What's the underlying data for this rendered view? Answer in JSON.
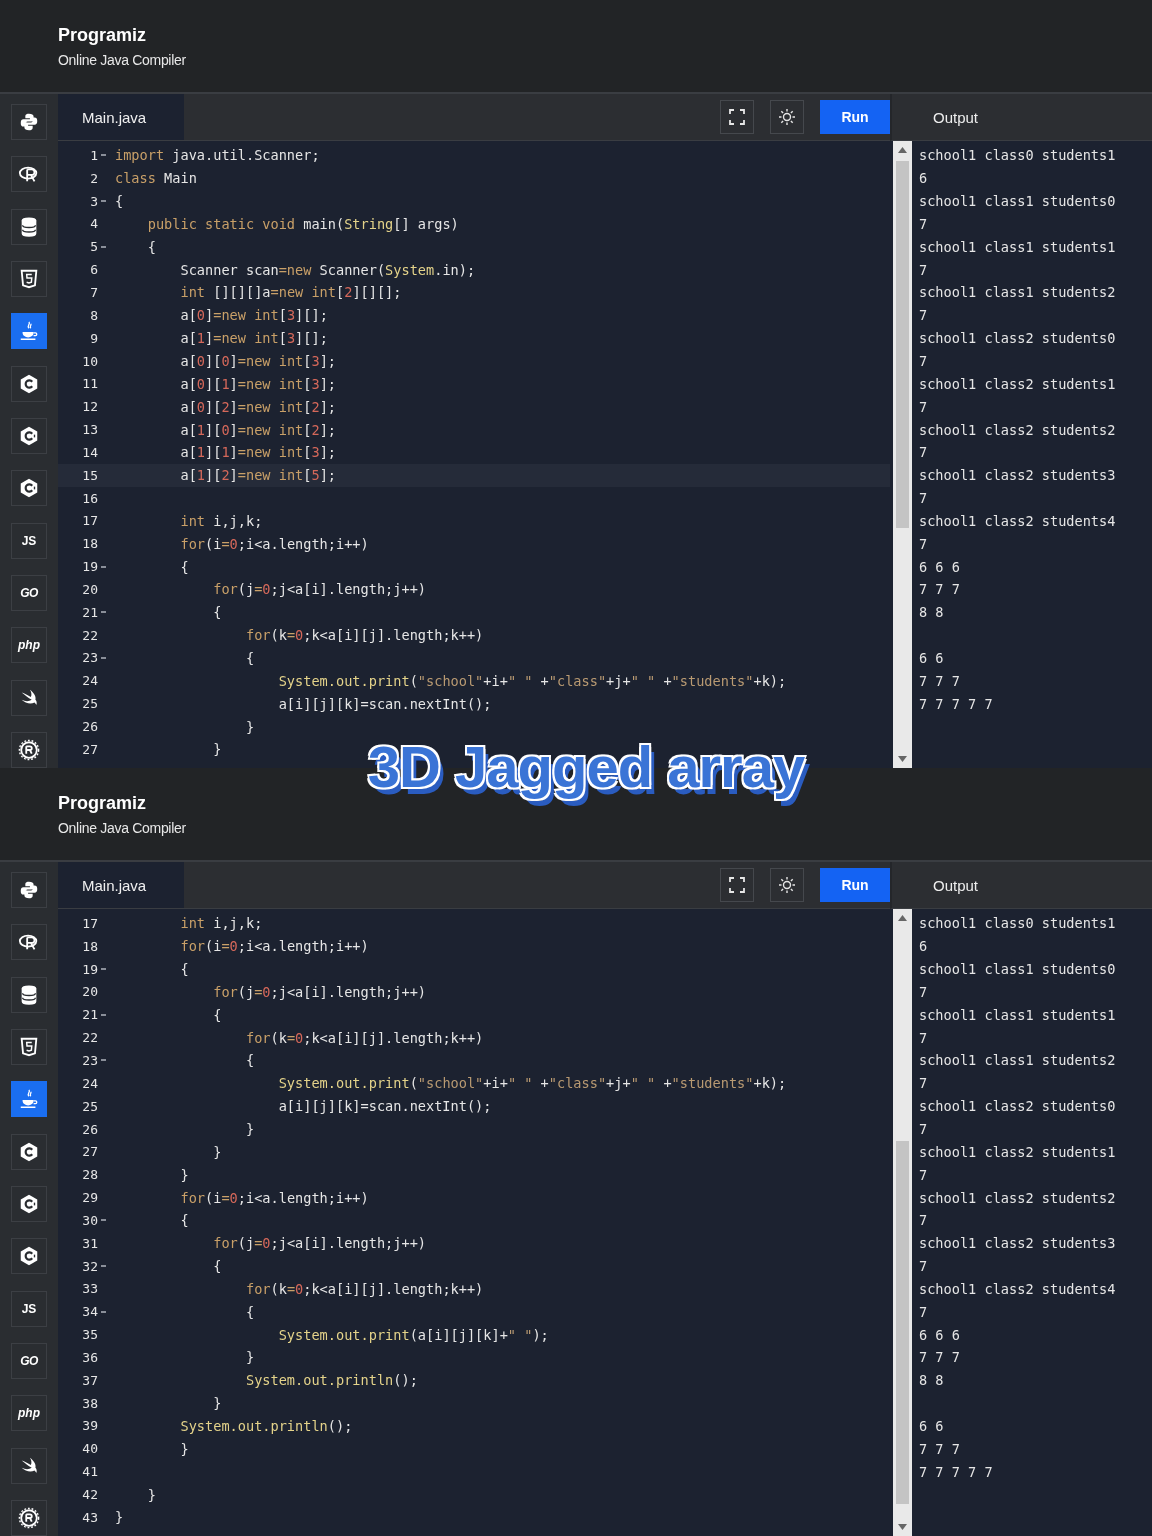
{
  "caption": "3D Jagged array",
  "panels": [
    {
      "header": {
        "logo": "Programiz",
        "subtitle": "Online Java Compiler"
      },
      "sidebar": {
        "items": [
          {
            "kind": "python",
            "selected": false
          },
          {
            "kind": "r",
            "selected": false
          },
          {
            "kind": "database",
            "selected": false
          },
          {
            "kind": "html",
            "selected": false
          },
          {
            "kind": "java",
            "selected": true
          },
          {
            "kind": "c",
            "selected": false
          },
          {
            "kind": "cpp",
            "selected": false
          },
          {
            "kind": "csharp",
            "selected": false
          },
          {
            "kind": "text",
            "label": "JS",
            "selected": false
          },
          {
            "kind": "go",
            "label": "GO",
            "selected": false
          },
          {
            "kind": "text",
            "label": "php",
            "italic": true,
            "selected": false
          },
          {
            "kind": "swift",
            "selected": false
          },
          {
            "kind": "rust",
            "selected": false
          }
        ]
      },
      "editor": {
        "tab": "Main.java",
        "run_label": "Run",
        "lines": [
          {
            "number": "1",
            "fold": true,
            "active": false,
            "segments": [
              {
                "kind": "keyword",
                "text": "import"
              },
              {
                "kind": "plain",
                "text": " java.util.Scanner;"
              }
            ]
          },
          {
            "number": "2",
            "fold": false,
            "active": false,
            "segments": [
              {
                "kind": "keyword",
                "text": "class"
              },
              {
                "kind": "plain",
                "text": " Main"
              }
            ]
          },
          {
            "number": "3",
            "fold": true,
            "active": false,
            "segments": [
              {
                "kind": "plain",
                "text": "{"
              }
            ]
          },
          {
            "number": "4",
            "fold": false,
            "active": false,
            "segments": [
              {
                "kind": "keyword",
                "text": "    public static void"
              },
              {
                "kind": "plain",
                "text": " main("
              },
              {
                "kind": "type",
                "text": "String"
              },
              {
                "kind": "plain",
                "text": "[] args)"
              }
            ]
          },
          {
            "number": "5",
            "fold": true,
            "active": false,
            "segments": [
              {
                "kind": "plain",
                "text": "    {"
              }
            ]
          },
          {
            "number": "6",
            "fold": false,
            "active": false,
            "segments": [
              {
                "kind": "plain",
                "text": "        Scanner scan"
              },
              {
                "kind": "keyword",
                "text": "=new"
              },
              {
                "kind": "plain",
                "text": " Scanner("
              },
              {
                "kind": "type",
                "text": "System"
              },
              {
                "kind": "plain",
                "text": ".in);"
              }
            ]
          },
          {
            "number": "7",
            "fold": false,
            "active": false,
            "segments": [
              {
                "kind": "keyword",
                "text": "        int"
              },
              {
                "kind": "plain",
                "text": " [][][]a"
              },
              {
                "kind": "keyword",
                "text": "=new int"
              },
              {
                "kind": "plain",
                "text": "["
              },
              {
                "kind": "number",
                "text": "2"
              },
              {
                "kind": "plain",
                "text": "][][];"
              }
            ]
          },
          {
            "number": "8",
            "fold": false,
            "active": false,
            "segments": [
              {
                "kind": "plain",
                "text": "        a["
              },
              {
                "kind": "number",
                "text": "0"
              },
              {
                "kind": "plain",
                "text": "]"
              },
              {
                "kind": "keyword",
                "text": "=new int"
              },
              {
                "kind": "plain",
                "text": "["
              },
              {
                "kind": "number",
                "text": "3"
              },
              {
                "kind": "plain",
                "text": "][];"
              }
            ]
          },
          {
            "number": "9",
            "fold": false,
            "active": false,
            "segments": [
              {
                "kind": "plain",
                "text": "        a["
              },
              {
                "kind": "number",
                "text": "1"
              },
              {
                "kind": "plain",
                "text": "]"
              },
              {
                "kind": "keyword",
                "text": "=new int"
              },
              {
                "kind": "plain",
                "text": "["
              },
              {
                "kind": "number",
                "text": "3"
              },
              {
                "kind": "plain",
                "text": "][];"
              }
            ]
          },
          {
            "number": "10",
            "fold": false,
            "active": false,
            "segments": [
              {
                "kind": "plain",
                "text": "        a["
              },
              {
                "kind": "number",
                "text": "0"
              },
              {
                "kind": "plain",
                "text": "]["
              },
              {
                "kind": "number",
                "text": "0"
              },
              {
                "kind": "plain",
                "text": "]"
              },
              {
                "kind": "keyword",
                "text": "=new int"
              },
              {
                "kind": "plain",
                "text": "["
              },
              {
                "kind": "number",
                "text": "3"
              },
              {
                "kind": "plain",
                "text": "];"
              }
            ]
          },
          {
            "number": "11",
            "fold": false,
            "active": false,
            "segments": [
              {
                "kind": "plain",
                "text": "        a["
              },
              {
                "kind": "number",
                "text": "0"
              },
              {
                "kind": "plain",
                "text": "]["
              },
              {
                "kind": "number",
                "text": "1"
              },
              {
                "kind": "plain",
                "text": "]"
              },
              {
                "kind": "keyword",
                "text": "=new int"
              },
              {
                "kind": "plain",
                "text": "["
              },
              {
                "kind": "number",
                "text": "3"
              },
              {
                "kind": "plain",
                "text": "];"
              }
            ]
          },
          {
            "number": "12",
            "fold": false,
            "active": false,
            "segments": [
              {
                "kind": "plain",
                "text": "        a["
              },
              {
                "kind": "number",
                "text": "0"
              },
              {
                "kind": "plain",
                "text": "]["
              },
              {
                "kind": "number",
                "text": "2"
              },
              {
                "kind": "plain",
                "text": "]"
              },
              {
                "kind": "keyword",
                "text": "=new int"
              },
              {
                "kind": "plain",
                "text": "["
              },
              {
                "kind": "number",
                "text": "2"
              },
              {
                "kind": "plain",
                "text": "];"
              }
            ]
          },
          {
            "number": "13",
            "fold": false,
            "active": false,
            "segments": [
              {
                "kind": "plain",
                "text": "        a["
              },
              {
                "kind": "number",
                "text": "1"
              },
              {
                "kind": "plain",
                "text": "]["
              },
              {
                "kind": "number",
                "text": "0"
              },
              {
                "kind": "plain",
                "text": "]"
              },
              {
                "kind": "keyword",
                "text": "=new int"
              },
              {
                "kind": "plain",
                "text": "["
              },
              {
                "kind": "number",
                "text": "2"
              },
              {
                "kind": "plain",
                "text": "];"
              }
            ]
          },
          {
            "number": "14",
            "fold": false,
            "active": false,
            "segments": [
              {
                "kind": "plain",
                "text": "        a["
              },
              {
                "kind": "number",
                "text": "1"
              },
              {
                "kind": "plain",
                "text": "]["
              },
              {
                "kind": "number",
                "text": "1"
              },
              {
                "kind": "plain",
                "text": "]"
              },
              {
                "kind": "keyword",
                "text": "=new int"
              },
              {
                "kind": "plain",
                "text": "["
              },
              {
                "kind": "number",
                "text": "3"
              },
              {
                "kind": "plain",
                "text": "];"
              }
            ]
          },
          {
            "number": "15",
            "fold": false,
            "active": true,
            "segments": [
              {
                "kind": "plain",
                "text": "        a["
              },
              {
                "kind": "number",
                "text": "1"
              },
              {
                "kind": "plain",
                "text": "]["
              },
              {
                "kind": "number",
                "text": "2"
              },
              {
                "kind": "plain",
                "text": "]"
              },
              {
                "kind": "keyword",
                "text": "=new int"
              },
              {
                "kind": "plain",
                "text": "["
              },
              {
                "kind": "number",
                "text": "5"
              },
              {
                "kind": "plain",
                "text": "];"
              }
            ]
          },
          {
            "number": "16",
            "fold": false,
            "active": false
          },
          {
            "number": "17",
            "fold": false,
            "active": false,
            "segments": [
              {
                "kind": "keyword",
                "text": "        int"
              },
              {
                "kind": "plain",
                "text": " i,j,k;"
              }
            ]
          },
          {
            "number": "18",
            "fold": false,
            "active": false,
            "segments": [
              {
                "kind": "keyword",
                "text": "        for"
              },
              {
                "kind": "plain",
                "text": "(i"
              },
              {
                "kind": "keyword",
                "text": "="
              },
              {
                "kind": "number",
                "text": "0"
              },
              {
                "kind": "plain",
                "text": ";i<a.length;i++)"
              }
            ]
          },
          {
            "number": "19",
            "fold": true,
            "active": false,
            "segments": [
              {
                "kind": "plain",
                "text": "        {"
              }
            ]
          },
          {
            "number": "20",
            "fold": false,
            "active": false,
            "segments": [
              {
                "kind": "keyword",
                "text": "            for"
              },
              {
                "kind": "plain",
                "text": "(j"
              },
              {
                "kind": "keyword",
                "text": "="
              },
              {
                "kind": "number",
                "text": "0"
              },
              {
                "kind": "plain",
                "text": ";j<a[i].length;j++)"
              }
            ]
          },
          {
            "number": "21",
            "fold": true,
            "active": false,
            "segments": [
              {
                "kind": "plain",
                "text": "            {"
              }
            ]
          },
          {
            "number": "22",
            "fold": false,
            "active": false,
            "segments": [
              {
                "kind": "keyword",
                "text": "                for"
              },
              {
                "kind": "plain",
                "text": "(k"
              },
              {
                "kind": "keyword",
                "text": "="
              },
              {
                "kind": "number",
                "text": "0"
              },
              {
                "kind": "plain",
                "text": ";k<a[i][j].length;k++)"
              }
            ]
          },
          {
            "number": "23",
            "fold": true,
            "active": false,
            "segments": [
              {
                "kind": "plain",
                "text": "                {"
              }
            ]
          },
          {
            "number": "24",
            "fold": false,
            "active": false,
            "segments": [
              {
                "kind": "type",
                "text": "                    System.out.print"
              },
              {
                "kind": "plain",
                "text": "("
              },
              {
                "kind": "string",
                "text": "\"school\""
              },
              {
                "kind": "plain",
                "text": "+i+"
              },
              {
                "kind": "string",
                "text": "\" \""
              },
              {
                "kind": "plain",
                "text": " +"
              },
              {
                "kind": "string",
                "text": "\"class\""
              },
              {
                "kind": "plain",
                "text": "+j+"
              },
              {
                "kind": "string",
                "text": "\" \""
              },
              {
                "kind": "plain",
                "text": " +"
              },
              {
                "kind": "string",
                "text": "\"students\""
              },
              {
                "kind": "plain",
                "text": "+k);"
              }
            ]
          },
          {
            "number": "25",
            "fold": false,
            "active": false,
            "segments": [
              {
                "kind": "plain",
                "text": "                    a[i][j][k]=scan.nextInt();"
              }
            ]
          },
          {
            "number": "26",
            "fold": false,
            "active": false,
            "segments": [
              {
                "kind": "plain",
                "text": "                }"
              }
            ]
          },
          {
            "number": "27",
            "fold": false,
            "active": false,
            "segments": [
              {
                "kind": "plain",
                "text": "            }"
              }
            ]
          }
        ]
      },
      "output": {
        "title": "Output",
        "scrolled": false,
        "groups": [
          [
            "school1 class0 students1",
            "6",
            "school1 class1 students0",
            "7",
            "school1 class1 students1",
            "7",
            "school1 class1 students2",
            "7",
            "school1 class2 students0",
            "7",
            "school1 class2 students1",
            "7",
            "school1 class2 students2",
            "7",
            "school1 class2 students3",
            "7",
            "school1 class2 students4",
            "7",
            "6 6 6",
            "7 7 7",
            "8 8"
          ],
          [
            "6 6",
            "7 7 7",
            "7 7 7 7 7"
          ]
        ]
      }
    },
    {
      "header": {
        "logo": "Programiz",
        "subtitle": "Online Java Compiler"
      },
      "sidebar": {
        "items": [
          {
            "kind": "python",
            "selected": false
          },
          {
            "kind": "r",
            "selected": false
          },
          {
            "kind": "database",
            "selected": false
          },
          {
            "kind": "html",
            "selected": false
          },
          {
            "kind": "java",
            "selected": true
          },
          {
            "kind": "c",
            "selected": false
          },
          {
            "kind": "cpp",
            "selected": false
          },
          {
            "kind": "csharp",
            "selected": false
          },
          {
            "kind": "text",
            "label": "JS",
            "selected": false
          },
          {
            "kind": "go",
            "label": "GO",
            "selected": false
          },
          {
            "kind": "text",
            "label": "php",
            "italic": true,
            "selected": false
          },
          {
            "kind": "swift",
            "selected": false
          },
          {
            "kind": "rust",
            "selected": false
          }
        ]
      },
      "editor": {
        "tab": "Main.java",
        "run_label": "Run",
        "lines": [
          {
            "number": "17",
            "fold": false,
            "active": false,
            "segments": [
              {
                "kind": "keyword",
                "text": "        int"
              },
              {
                "kind": "plain",
                "text": " i,j,k;"
              }
            ]
          },
          {
            "number": "18",
            "fold": false,
            "active": false,
            "segments": [
              {
                "kind": "keyword",
                "text": "        for"
              },
              {
                "kind": "plain",
                "text": "(i"
              },
              {
                "kind": "keyword",
                "text": "="
              },
              {
                "kind": "number",
                "text": "0"
              },
              {
                "kind": "plain",
                "text": ";i<a.length;i++)"
              }
            ]
          },
          {
            "number": "19",
            "fold": true,
            "active": false,
            "segments": [
              {
                "kind": "plain",
                "text": "        {"
              }
            ]
          },
          {
            "number": "20",
            "fold": false,
            "active": false,
            "segments": [
              {
                "kind": "keyword",
                "text": "            for"
              },
              {
                "kind": "plain",
                "text": "(j"
              },
              {
                "kind": "keyword",
                "text": "="
              },
              {
                "kind": "number",
                "text": "0"
              },
              {
                "kind": "plain",
                "text": ";j<a[i].length;j++)"
              }
            ]
          },
          {
            "number": "21",
            "fold": true,
            "active": false,
            "segments": [
              {
                "kind": "plain",
                "text": "            {"
              }
            ]
          },
          {
            "number": "22",
            "fold": false,
            "active": false,
            "segments": [
              {
                "kind": "keyword",
                "text": "                for"
              },
              {
                "kind": "plain",
                "text": "(k"
              },
              {
                "kind": "keyword",
                "text": "="
              },
              {
                "kind": "number",
                "text": "0"
              },
              {
                "kind": "plain",
                "text": ";k<a[i][j].length;k++)"
              }
            ]
          },
          {
            "number": "23",
            "fold": true,
            "active": false,
            "segments": [
              {
                "kind": "plain",
                "text": "                {"
              }
            ]
          },
          {
            "number": "24",
            "fold": false,
            "active": false,
            "segments": [
              {
                "kind": "type",
                "text": "                    System.out.print"
              },
              {
                "kind": "plain",
                "text": "("
              },
              {
                "kind": "string",
                "text": "\"school\""
              },
              {
                "kind": "plain",
                "text": "+i+"
              },
              {
                "kind": "string",
                "text": "\" \""
              },
              {
                "kind": "plain",
                "text": " +"
              },
              {
                "kind": "string",
                "text": "\"class\""
              },
              {
                "kind": "plain",
                "text": "+j+"
              },
              {
                "kind": "string",
                "text": "\" \""
              },
              {
                "kind": "plain",
                "text": " +"
              },
              {
                "kind": "string",
                "text": "\"students\""
              },
              {
                "kind": "plain",
                "text": "+k);"
              }
            ]
          },
          {
            "number": "25",
            "fold": false,
            "active": false,
            "segments": [
              {
                "kind": "plain",
                "text": "                    a[i][j][k]=scan.nextInt();"
              }
            ]
          },
          {
            "number": "26",
            "fold": false,
            "active": false,
            "segments": [
              {
                "kind": "plain",
                "text": "                }"
              }
            ]
          },
          {
            "number": "27",
            "fold": false,
            "active": false,
            "segments": [
              {
                "kind": "plain",
                "text": "            }"
              }
            ]
          },
          {
            "number": "28",
            "fold": false,
            "active": false,
            "segments": [
              {
                "kind": "plain",
                "text": "        }"
              }
            ]
          },
          {
            "number": "29",
            "fold": false,
            "active": false,
            "segments": [
              {
                "kind": "keyword",
                "text": "        for"
              },
              {
                "kind": "plain",
                "text": "(i"
              },
              {
                "kind": "keyword",
                "text": "="
              },
              {
                "kind": "number",
                "text": "0"
              },
              {
                "kind": "plain",
                "text": ";i<a.length;i++)"
              }
            ]
          },
          {
            "number": "30",
            "fold": true,
            "active": false,
            "segments": [
              {
                "kind": "plain",
                "text": "        {"
              }
            ]
          },
          {
            "number": "31",
            "fold": false,
            "active": false,
            "segments": [
              {
                "kind": "keyword",
                "text": "            for"
              },
              {
                "kind": "plain",
                "text": "(j"
              },
              {
                "kind": "keyword",
                "text": "="
              },
              {
                "kind": "number",
                "text": "0"
              },
              {
                "kind": "plain",
                "text": ";j<a[i].length;j++)"
              }
            ]
          },
          {
            "number": "32",
            "fold": true,
            "active": false,
            "segments": [
              {
                "kind": "plain",
                "text": "            {"
              }
            ]
          },
          {
            "number": "33",
            "fold": false,
            "active": false,
            "segments": [
              {
                "kind": "keyword",
                "text": "                for"
              },
              {
                "kind": "plain",
                "text": "(k"
              },
              {
                "kind": "keyword",
                "text": "="
              },
              {
                "kind": "number",
                "text": "0"
              },
              {
                "kind": "plain",
                "text": ";k<a[i][j].length;k++)"
              }
            ]
          },
          {
            "number": "34",
            "fold": true,
            "active": false,
            "segments": [
              {
                "kind": "plain",
                "text": "                {"
              }
            ]
          },
          {
            "number": "35",
            "fold": false,
            "active": false,
            "segments": [
              {
                "kind": "type",
                "text": "                    System.out.print"
              },
              {
                "kind": "plain",
                "text": "(a[i][j][k]+"
              },
              {
                "kind": "string",
                "text": "\" \""
              },
              {
                "kind": "plain",
                "text": ");"
              }
            ]
          },
          {
            "number": "36",
            "fold": false,
            "active": false,
            "segments": [
              {
                "kind": "plain",
                "text": "                }"
              }
            ]
          },
          {
            "number": "37",
            "fold": false,
            "active": false,
            "segments": [
              {
                "kind": "type",
                "text": "                System.out.println"
              },
              {
                "kind": "plain",
                "text": "();"
              }
            ]
          },
          {
            "number": "38",
            "fold": false,
            "active": false,
            "segments": [
              {
                "kind": "plain",
                "text": "            }"
              }
            ]
          },
          {
            "number": "39",
            "fold": false,
            "active": false,
            "segments": [
              {
                "kind": "type",
                "text": "        System.out.println"
              },
              {
                "kind": "plain",
                "text": "();"
              }
            ]
          },
          {
            "number": "40",
            "fold": false,
            "active": false,
            "segments": [
              {
                "kind": "plain",
                "text": "        }"
              }
            ]
          },
          {
            "number": "41",
            "fold": false,
            "active": false
          },
          {
            "number": "42",
            "fold": false,
            "active": false,
            "segments": [
              {
                "kind": "plain",
                "text": "    }"
              }
            ]
          },
          {
            "number": "43",
            "fold": false,
            "active": false,
            "segments": [
              {
                "kind": "plain",
                "text": "}"
              }
            ]
          }
        ]
      },
      "output": {
        "title": "Output",
        "scrolled": true,
        "groups": [
          [
            "school1 class0 students1",
            "6",
            "school1 class1 students0",
            "7",
            "school1 class1 students1",
            "7",
            "school1 class1 students2",
            "7",
            "school1 class2 students0",
            "7",
            "school1 class2 students1",
            "7",
            "school1 class2 students2",
            "7",
            "school1 class2 students3",
            "7",
            "school1 class2 students4",
            "7",
            "6 6 6",
            "7 7 7",
            "8 8"
          ],
          [
            "6 6",
            "7 7 7",
            "7 7 7 7 7"
          ]
        ]
      }
    }
  ]
}
